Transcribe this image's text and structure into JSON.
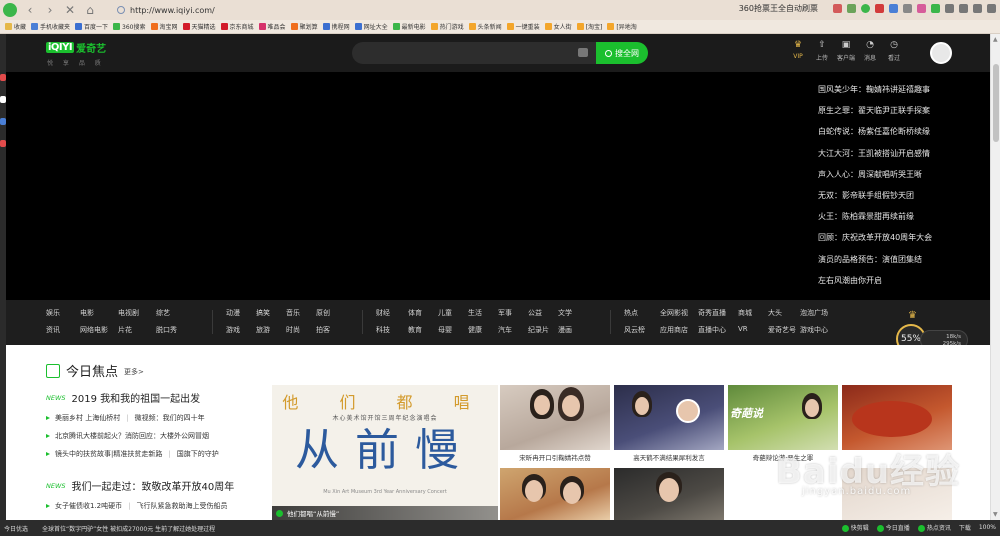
{
  "browser": {
    "url": "http://www.iqiyi.com/",
    "promo_text": "360抢票王全自动刷票",
    "bookmarks": [
      {
        "label": "收藏",
        "color": "#e5b84a"
      },
      {
        "label": "手机收藏夹",
        "color": "#4a7fd6"
      },
      {
        "label": "百度一下",
        "color": "#3b6fd0"
      },
      {
        "label": "360搜索",
        "color": "#3bb64a"
      },
      {
        "label": "淘宝网",
        "color": "#f06e1d"
      },
      {
        "label": "天猫精选",
        "color": "#d21b2a"
      },
      {
        "label": "京东商城",
        "color": "#d21b2a"
      },
      {
        "label": "唯品会",
        "color": "#d6326b"
      },
      {
        "label": "聚划算",
        "color": "#f06e1d"
      },
      {
        "label": "携程网",
        "color": "#3b6fd0"
      },
      {
        "label": "网址大全",
        "color": "#3b6fd0"
      },
      {
        "label": "最新电影",
        "color": "#3bb64a"
      },
      {
        "label": "热门游戏",
        "color": "#f3a62b"
      },
      {
        "label": "头条新闻",
        "color": "#f3a62b"
      },
      {
        "label": "一键重装",
        "color": "#f3a62b"
      },
      {
        "label": "女人街",
        "color": "#f3a62b"
      },
      {
        "label": "[淘宝]",
        "color": "#f3a62b"
      },
      {
        "label": "[异地淘",
        "color": "#f3a62b"
      }
    ]
  },
  "site": {
    "logo_text": "iQIYI",
    "logo_name": "爱奇艺",
    "logo_sub": "悦 享 品 质",
    "search_placeholder": "",
    "search_button": "搜全网",
    "tools": [
      {
        "label": "VIP",
        "icon": "crown-icon",
        "glyph": "♛"
      },
      {
        "label": "上传",
        "icon": "upload-icon",
        "glyph": "⇧"
      },
      {
        "label": "客户端",
        "icon": "client-icon",
        "glyph": "▣"
      },
      {
        "label": "消息",
        "icon": "bell-icon",
        "glyph": "◔"
      },
      {
        "label": "看过",
        "icon": "history-icon",
        "glyph": "◷"
      }
    ],
    "vip_badge": "VIP"
  },
  "hero": {
    "items": [
      "国风美少年：鞠婧祎讲延禧趣事",
      "原生之罪：翟天临尹正联手探案",
      "白蛇传说：杨紫任嘉伦断桥续缘",
      "大江大河：王凯被搭讪开启感情",
      "声入人心：周深献唱听哭王晰",
      "无双：影帝联手组假钞天团",
      "火王：陈柏霖景甜再续前缘",
      "回顾：庆祝改革开放40周年大会",
      "演员的品格预告：演值团集结",
      "左右风潮由你开启"
    ]
  },
  "categories": [
    {
      "row1": [
        "娱乐",
        "电影",
        "电视剧",
        "综艺"
      ],
      "row2": [
        "资讯",
        "网络电影",
        "片花",
        "脱口秀"
      ]
    },
    {
      "row1": [
        "动漫",
        "搞笑",
        "音乐",
        "原创"
      ],
      "row2": [
        "游戏",
        "旅游",
        "时尚",
        "拍客"
      ]
    },
    {
      "row1": [
        "财经",
        "体育",
        "儿童",
        "生活",
        "军事",
        "公益",
        "文学"
      ],
      "row2": [
        "科技",
        "教育",
        "母婴",
        "健康",
        "汽车",
        "纪录片",
        "漫画"
      ]
    },
    {
      "row1": [
        "热点",
        "全网影视",
        "奇秀直播",
        "商城",
        "大头",
        "泡泡广场"
      ],
      "row2": [
        "风云榜",
        "应用商店",
        "直播中心",
        "VR",
        "爱奇艺号",
        "游戏中心"
      ]
    }
  ],
  "widget": {
    "percent": "55%",
    "up": "18k/s",
    "down": "295k/s"
  },
  "focus": {
    "title": "今日焦点",
    "more": "更多>",
    "news1": {
      "tag": "NEWS",
      "headline": "2019 我和我的祖国一起出发",
      "lines": [
        [
          "美丽乡村 上海仙桥村",
          "微视频：我们的四十年"
        ],
        [
          "北京腾讯大楼前起火？消防回应：大楼外公网冒烟"
        ],
        [
          "镜头中的扶贫故事|精准扶贫走新路",
          "国旗下的守护"
        ]
      ]
    },
    "news2": {
      "tag": "NEWS",
      "headline": "我们一起走过：致敬改革开放40周年",
      "lines": [
        [
          "女子催债收1.2吨硬币",
          "飞行队紧急救助海上受伤船员"
        ]
      ]
    },
    "poster": {
      "top_text": "他 们 都 唱",
      "sub_text": "木心美术馆开馆三周年纪念演唱会",
      "big_text": "从前慢",
      "en_text": "Mu Xin Art Museum 3rd Year Anniversary Concert",
      "caption": "他们都唱“从前慢”"
    },
    "thumbs": [
      {
        "caption": "宋昕冉开口引鞠婧祎点赞"
      },
      {
        "caption": "高天鹤不满结果犀利发言"
      },
      {
        "caption": "奇葩辩论游·恶生之罪"
      },
      {
        "caption": ""
      }
    ]
  },
  "status": {
    "left": [
      "今日优选",
      "全球首位“数字円驴”女性 被扣成27000元 生前了解过她处理过程"
    ],
    "right": [
      "快剪辑",
      "今日直播",
      "热点资讯",
      "下载",
      "100%"
    ]
  },
  "watermark": {
    "main": "Baidu经验",
    "sub": "jingyan.baidu.com"
  }
}
